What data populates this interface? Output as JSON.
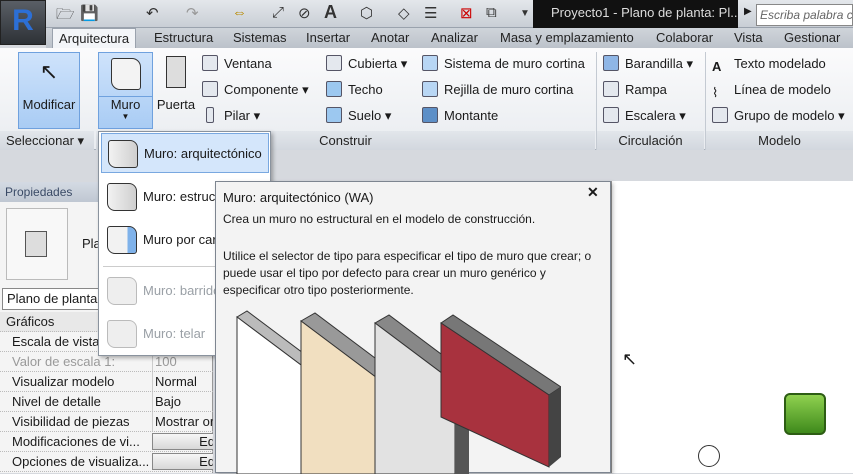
{
  "app": {
    "title": "Proyecto1 - Plano de planta: Pl...",
    "search_placeholder": "Escriba palabra cla",
    "logo": "R"
  },
  "tabs": [
    "Arquitectura",
    "Estructura",
    "Sistemas",
    "Insertar",
    "Anotar",
    "Analizar",
    "Masa y emplazamiento",
    "Colaborar",
    "Vista",
    "Gestionar"
  ],
  "ribbon": {
    "modificar": "Modificar",
    "muro": "Muro",
    "puerta": "Puerta",
    "construir": [
      "Ventana",
      "Componente",
      "Pilar",
      "Cubierta",
      "Techo",
      "Suelo",
      "Sistema de muro cortina",
      "Rejilla de muro cortina",
      "Montante"
    ],
    "circulacion": [
      "Barandilla",
      "Rampa",
      "Escalera"
    ],
    "modelo": [
      "Texto modelado",
      "Línea de modelo",
      "Grupo de modelo"
    ],
    "panels": [
      "Seleccionar",
      "Construir",
      "Circulación",
      "Modelo"
    ]
  },
  "menu": [
    "Muro: arquitectónico",
    "Muro: estructural",
    "Muro por cara",
    "Muro: barrido",
    "Muro: telar"
  ],
  "properties": {
    "title": "Propiedades",
    "type": "Plano de planta",
    "type_label": "Pla",
    "section": "Gráficos",
    "rows": [
      {
        "k": "Escala de vista",
        "v": ""
      },
      {
        "k": "Valor de escala    1:",
        "v": "100"
      },
      {
        "k": "Visualizar modelo",
        "v": "Normal"
      },
      {
        "k": "Nivel de detalle",
        "v": "Bajo"
      },
      {
        "k": "Visibilidad de piezas",
        "v": "Mostrar or"
      },
      {
        "k": "Modificaciones de vi...",
        "v": "Ed"
      },
      {
        "k": "Opciones de visualiza...",
        "v": "Ed"
      }
    ]
  },
  "tooltip": {
    "title": "Muro: arquitectónico (WA)",
    "desc": "Crea un muro no estructural en el modelo de construcción.",
    "body": "Utilice el selector de tipo para especificar el tipo de muro que crear; o puede usar el tipo por defecto para crear un muro genérico y especificar otro tipo posteriormente."
  },
  "close": "✕"
}
